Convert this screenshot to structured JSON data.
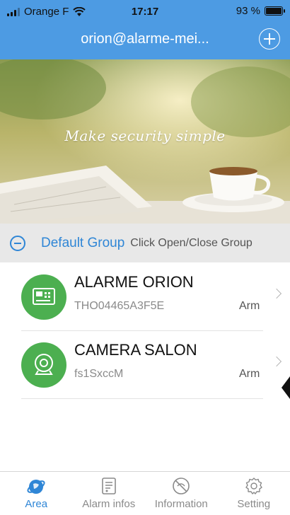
{
  "status_bar": {
    "carrier": "Orange F",
    "time": "17:17",
    "battery": "93 %"
  },
  "nav": {
    "title": "orion@alarme-mei..."
  },
  "banner": {
    "tagline": "Make security simple"
  },
  "group": {
    "name": "Default Group",
    "hint": "Click Open/Close Group"
  },
  "devices": [
    {
      "name": "ALARME ORION",
      "serial": "THO04465A3F5E",
      "state": "Arm",
      "icon": "alarm-panel-icon"
    },
    {
      "name": "CAMERA SALON",
      "serial": "fs1SxccM",
      "state": "Arm",
      "icon": "camera-icon"
    }
  ],
  "tabs": [
    {
      "label": "Area",
      "icon": "area-icon",
      "active": true
    },
    {
      "label": "Alarm infos",
      "icon": "alarm-infos-icon",
      "active": false
    },
    {
      "label": "Information",
      "icon": "information-icon",
      "active": false
    },
    {
      "label": "Setting",
      "icon": "setting-icon",
      "active": false
    }
  ],
  "colors": {
    "header": "#4d9be3",
    "accent": "#2f86d6",
    "device_icon_bg": "#4caf50"
  }
}
